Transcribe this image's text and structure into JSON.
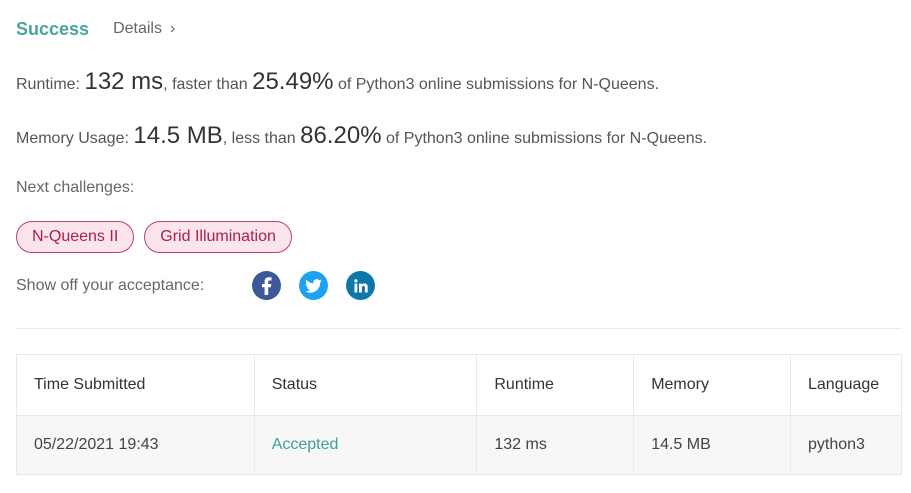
{
  "header": {
    "status": "Success",
    "details_label": "Details",
    "details_chevron": "›"
  },
  "runtime": {
    "label": "Runtime: ",
    "value": "132 ms",
    "mid": ", faster than ",
    "percent": "25.49%",
    "suffix": " of Python3 online submissions for N-Queens."
  },
  "memory": {
    "label": "Memory Usage: ",
    "value": "14.5 MB",
    "mid": ", less than ",
    "percent": "86.20%",
    "suffix": " of Python3 online submissions for N-Queens."
  },
  "next_challenges": {
    "label": "Next challenges:",
    "items": [
      {
        "label": "N-Queens II"
      },
      {
        "label": "Grid Illumination"
      }
    ]
  },
  "share": {
    "label": "Show off your acceptance:",
    "icons": [
      {
        "name": "facebook-icon",
        "color": "#3b5998"
      },
      {
        "name": "twitter-icon",
        "color": "#1da1f2"
      },
      {
        "name": "linkedin-icon",
        "color": "#0e76a8"
      }
    ]
  },
  "table": {
    "headers": [
      "Time Submitted",
      "Status",
      "Runtime",
      "Memory",
      "Language"
    ],
    "rows": [
      {
        "time": "05/22/2021 19:43",
        "status": "Accepted",
        "runtime": "132 ms",
        "memory": "14.5 MB",
        "language": "python3"
      }
    ]
  },
  "colors": {
    "success": "#4aa59b",
    "tag_border": "#c2406e",
    "tag_bg": "#fbe4ea",
    "accepted": "#3f9f93"
  }
}
